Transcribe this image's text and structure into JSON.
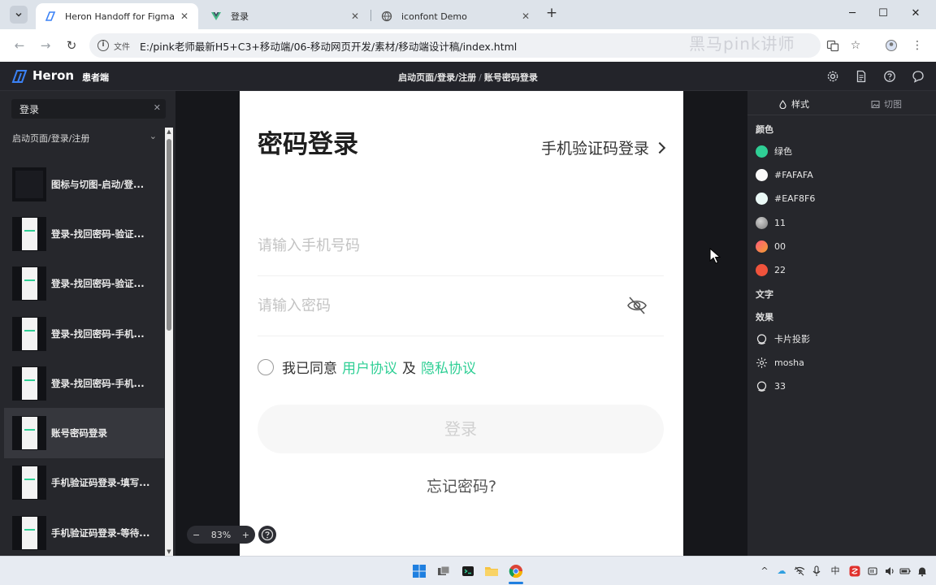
{
  "browser": {
    "tabs": [
      {
        "label": "Heron Handoff for Figma",
        "icon": "heron-favicon"
      },
      {
        "label": "登录",
        "icon": "vue-favicon"
      },
      {
        "label": "iconfont Demo",
        "icon": "globe-favicon"
      }
    ],
    "file_label": "文件",
    "url": "E:/pink老师最新H5+C3+移动端/06-移动网页开发/素材/移动端设计稿/index.html",
    "watermark": "黑马pink讲师"
  },
  "app": {
    "brand": "Heron",
    "sub": "患者端",
    "breadcrumb": {
      "parent": "启动页面/登录/注册",
      "sep": "/",
      "current": "账号密码登录"
    }
  },
  "sidebar": {
    "search_value": "登录",
    "group": "启动页面/登录/注册",
    "pages": [
      {
        "label": "图标与切图-启动/登...",
        "dark": true
      },
      {
        "label": "登录-找回密码-验证...",
        "dark": false
      },
      {
        "label": "登录-找回密码-验证...",
        "dark": false
      },
      {
        "label": "登录-找回密码-手机...",
        "dark": false
      },
      {
        "label": "登录-找回密码-手机...",
        "dark": false
      },
      {
        "label": "账号密码登录",
        "dark": false,
        "selected": true
      },
      {
        "label": "手机验证码登录-填写...",
        "dark": false
      },
      {
        "label": "手机验证码登录-等待...",
        "dark": false
      }
    ]
  },
  "artboard": {
    "title": "密码登录",
    "sms_login": "手机验证码登录",
    "phone_placeholder": "请输入手机号码",
    "password_placeholder": "请输入密码",
    "agree_prefix": "我已同意",
    "user_agreement": "用户协议",
    "and": "及",
    "privacy_agreement": "隐私协议",
    "login_button": "登录",
    "forgot": "忘记密码?",
    "accent": "#2fcf95"
  },
  "zoom": {
    "minus": "−",
    "value": "83%",
    "plus": "+"
  },
  "right_panel": {
    "tab_style": "样式",
    "tab_slice": "切图",
    "colors_title": "颜色",
    "colors": [
      {
        "name": "绿色",
        "color": "#2fcf95"
      },
      {
        "name": "#FAFAFA",
        "color": "#FAFAFA"
      },
      {
        "name": "#EAF8F6",
        "color": "#EAF8F6"
      },
      {
        "name": "11",
        "color": "#9a9a9a"
      },
      {
        "name": "00",
        "color": "#f2616f"
      },
      {
        "name": "22",
        "color": "#f0533c"
      }
    ],
    "text_title": "文字",
    "effects_title": "效果",
    "effects": [
      {
        "name": "卡片投影",
        "icon": "shadow-icon"
      },
      {
        "name": "mosha",
        "icon": "blur-icon"
      },
      {
        "name": "33",
        "icon": "shadow-icon"
      }
    ]
  },
  "taskbar": {
    "ime": "中"
  }
}
